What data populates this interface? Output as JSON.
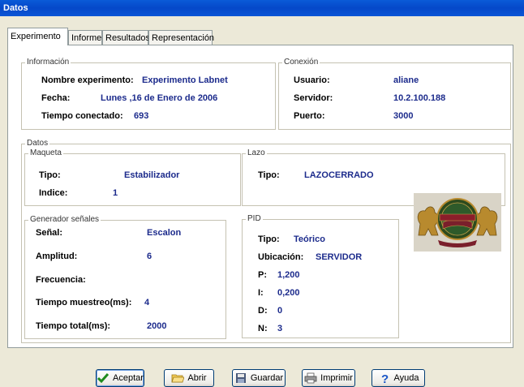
{
  "window": {
    "title": "Datos"
  },
  "tabs": [
    "Experimento",
    "Informe",
    "Resultados",
    "Representación"
  ],
  "informacion": {
    "label": "Información",
    "nombre_label": "Nombre experimento:",
    "nombre": "Experimento Labnet",
    "fecha_label": "Fecha:",
    "fecha": "Lunes ,16 de Enero de 2006",
    "tiempo_label": "Tiempo conectado:",
    "tiempo": "693"
  },
  "conexion": {
    "label": "Conexión",
    "usuario_label": "Usuario:",
    "usuario": "aliane",
    "servidor_label": "Servidor:",
    "servidor": "10.2.100.188",
    "puerto_label": "Puerto:",
    "puerto": "3000"
  },
  "datos": {
    "label": "Datos"
  },
  "maqueta": {
    "label": "Maqueta",
    "tipo_label": "Tipo:",
    "tipo": "Estabilizador",
    "indice_label": "Indice:",
    "indice": "1"
  },
  "lazo": {
    "label": "Lazo",
    "tipo_label": "Tipo:",
    "tipo": "LAZOCERRADO"
  },
  "generador": {
    "label": "Generador señales",
    "senal_label": "Señal:",
    "senal": "Escalon",
    "amplitud_label": "Amplitud:",
    "amplitud": "6",
    "frecuencia_label": "Frecuencia:",
    "frecuencia": "",
    "muestreo_label": "Tiempo muestreo(ms):",
    "muestreo": "4",
    "total_label": "Tiempo total(ms):",
    "total": "2000"
  },
  "pid": {
    "label": "PID",
    "tipo_label": "Tipo:",
    "tipo": "Teórico",
    "ubicacion_label": "Ubicación:",
    "ubicacion": "SERVIDOR",
    "p_label": "P:",
    "p": "1,200",
    "i_label": "I:",
    "i": "0,200",
    "d_label": "D:",
    "d": "0",
    "n_label": "N:",
    "n": "3"
  },
  "buttons": {
    "aceptar": "Aceptar",
    "abrir": "Abrir",
    "guardar": "Guardar",
    "imprimir": "Imprimir",
    "ayuda": "Ayuda"
  }
}
